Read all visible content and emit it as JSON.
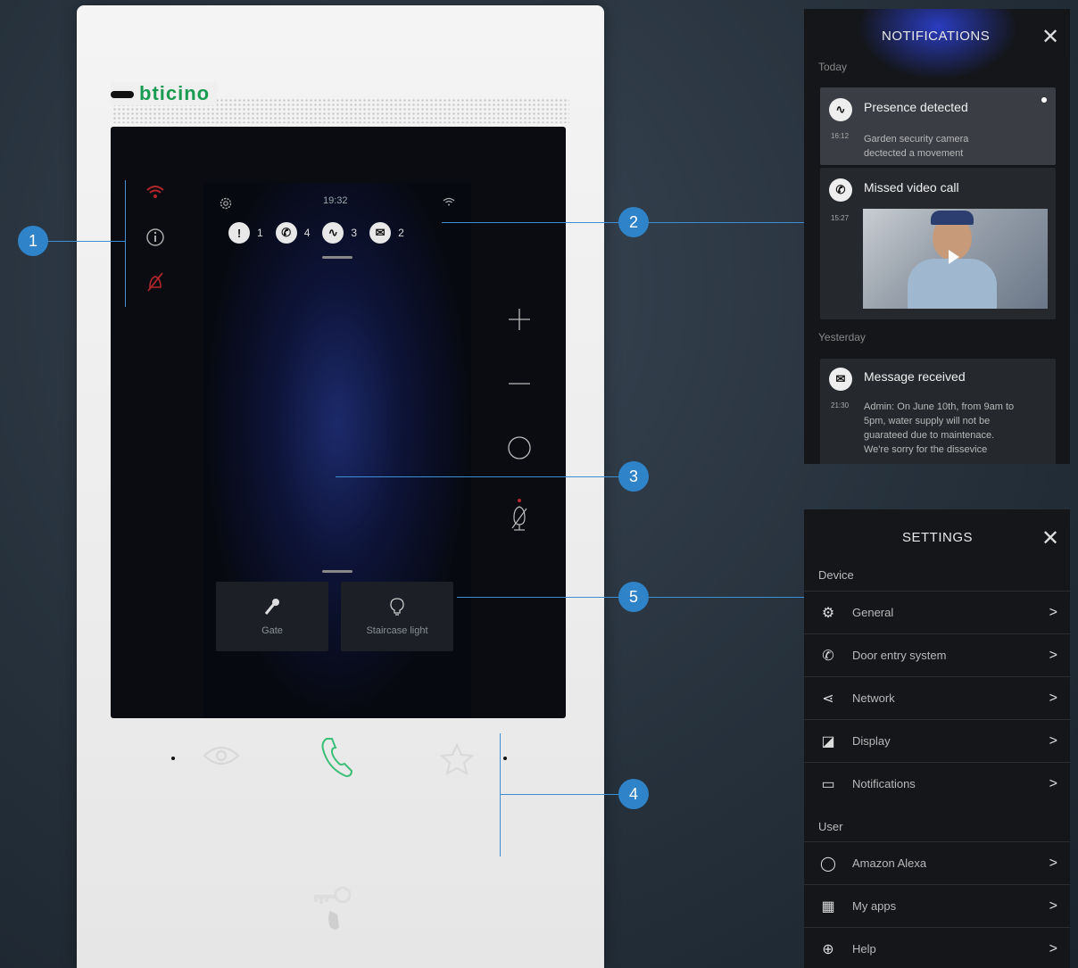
{
  "device": {
    "brand": "bticino",
    "status_time": "19:32",
    "badges": [
      {
        "icon": "alert-icon",
        "glyph": "!",
        "count": "1"
      },
      {
        "icon": "phone-icon",
        "glyph": "✆",
        "count": "4"
      },
      {
        "icon": "activity-icon",
        "glyph": "∿",
        "count": "3"
      },
      {
        "icon": "message-icon",
        "glyph": "✉",
        "count": "2"
      }
    ],
    "tiles": [
      {
        "label": "Gate",
        "icon": "gate-icon"
      },
      {
        "label": "Staircase light",
        "icon": "bulb-icon"
      }
    ],
    "side_icons": [
      "wifi-icon",
      "info-icon",
      "mute-icon"
    ],
    "right_controls": [
      "plus-icon",
      "minus-icon",
      "circle-icon",
      "mic-off-icon"
    ],
    "bottom_buttons": [
      "eye-icon",
      "phone-icon",
      "star-icon"
    ]
  },
  "callouts": [
    "1",
    "2",
    "3",
    "4",
    "5"
  ],
  "notifications": {
    "title": "NOTIFICATIONS",
    "close": "✕",
    "today_label": "Today",
    "yesterday_label": "Yesterday",
    "items": [
      {
        "title": "Presence detected",
        "time": "16:12",
        "body_line1": "Garden security camera",
        "body_line2": "dectected a movement"
      },
      {
        "title": "Missed video call",
        "time": "15:27"
      },
      {
        "title": "Message received",
        "time": "21:30",
        "body_line1": "Admin: On June 10th, from 9am to",
        "body_line2": "5pm, water supply will not be",
        "body_line3": "guarateed due to maintenace.",
        "body_line4": "We're sorry for the dissevice"
      }
    ]
  },
  "settings": {
    "title": "SETTINGS",
    "close": "✕",
    "device_label": "Device",
    "user_label": "User",
    "device_items": [
      {
        "label": "General",
        "glyph": "⚙"
      },
      {
        "label": "Door entry system",
        "glyph": "✆"
      },
      {
        "label": "Network",
        "glyph": "⋖"
      },
      {
        "label": "Display",
        "glyph": "◪"
      },
      {
        "label": "Notifications",
        "glyph": "▭"
      }
    ],
    "user_items": [
      {
        "label": "Amazon Alexa",
        "glyph": "◯"
      },
      {
        "label": "My apps",
        "glyph": "▦"
      },
      {
        "label": "Help",
        "glyph": "⊕"
      }
    ],
    "chevron": ">"
  },
  "colors": {
    "accent": "#2f83c9",
    "brand_green": "#1a9b52",
    "alert_red": "#b3262b",
    "call_green": "#3cbf78"
  }
}
